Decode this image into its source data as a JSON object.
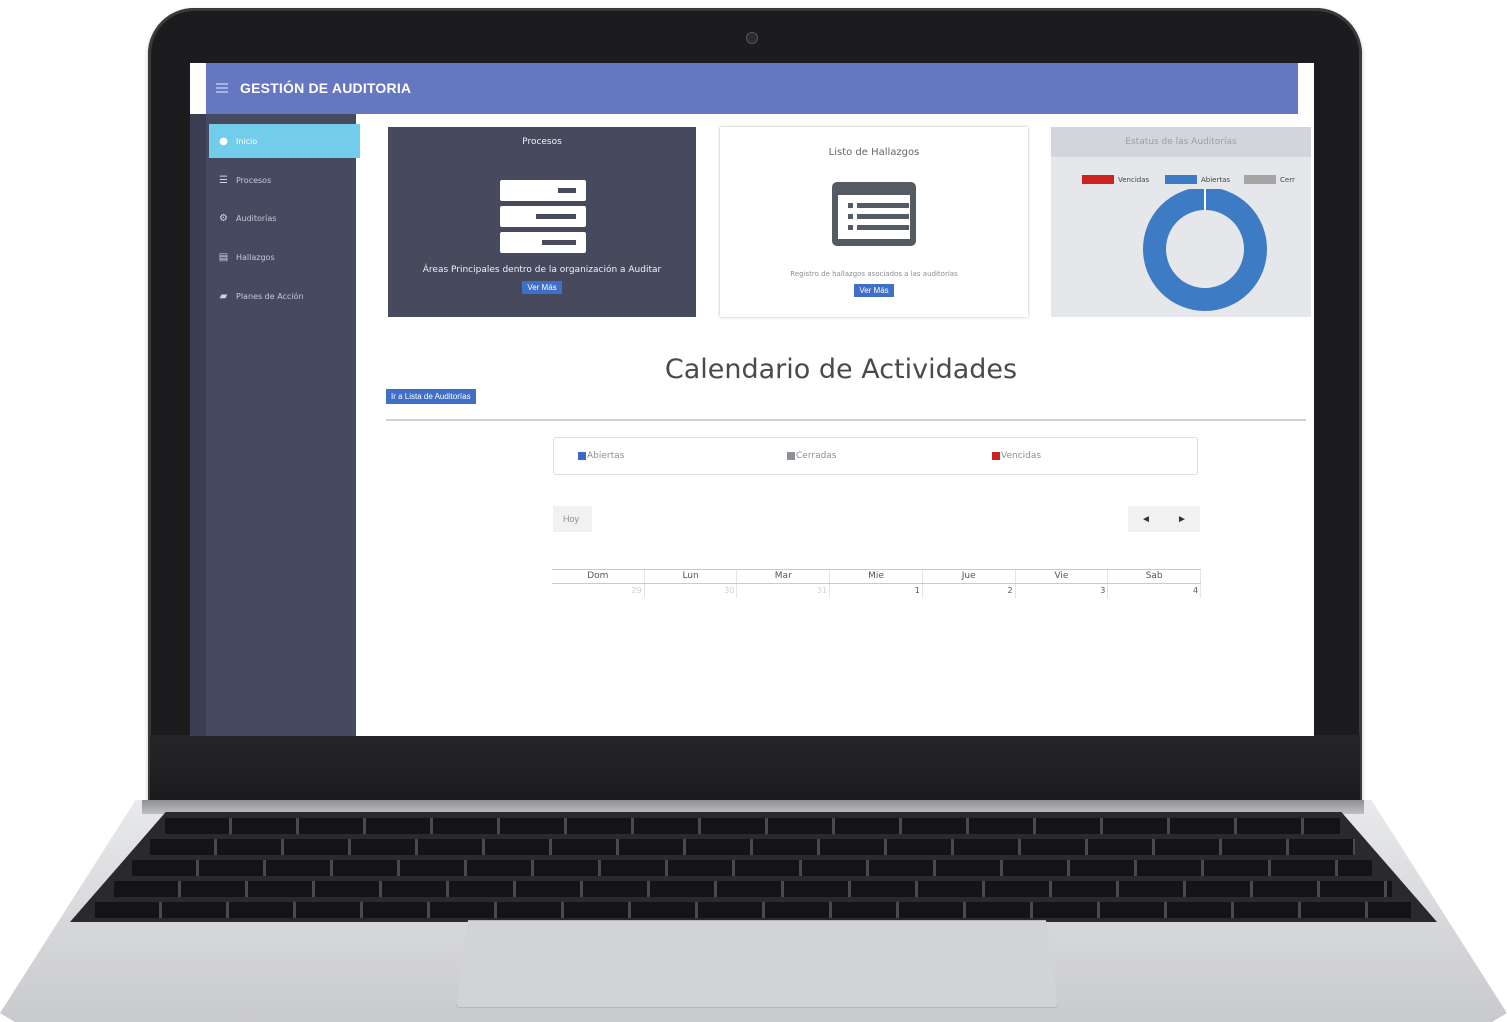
{
  "app": {
    "title": "GESTIÓN DE AUDITORIA"
  },
  "sidebar": {
    "items": [
      {
        "label": "Inicio",
        "icon": "dashboard-icon",
        "active": true
      },
      {
        "label": "Procesos",
        "icon": "server-icon",
        "active": false
      },
      {
        "label": "Auditorías",
        "icon": "cogs-icon",
        "active": false
      },
      {
        "label": "Hallazgos",
        "icon": "list-icon",
        "active": false
      },
      {
        "label": "Planes de Acción",
        "icon": "book-icon",
        "active": false
      }
    ]
  },
  "cards": {
    "procesos": {
      "title": "Procesos",
      "description": "Áreas Principales dentro de la organización a Auditar",
      "button": "Ver Más",
      "icon": "server-icon"
    },
    "hallazgos": {
      "title": "Listo de Hallazgos",
      "description": "Registro de hallazgos asociados a las auditorías",
      "button": "Ver Más",
      "icon": "list-icon"
    },
    "estatus": {
      "title": "Estatus de las Auditorías",
      "legend": [
        {
          "label": "Vencidas",
          "color": "#cc2222"
        },
        {
          "label": "Abiertas",
          "color": "#3d7cc4"
        },
        {
          "label": "Cerr",
          "color": "#a6a6a6"
        }
      ]
    }
  },
  "chart_data": {
    "type": "pie",
    "title": "Estatus de las Auditorías",
    "donut": true,
    "legend_position": "top",
    "slices": [
      {
        "label": "Vencidas",
        "value": 0,
        "color": "#cc2222"
      },
      {
        "label": "Abiertas",
        "value": 100,
        "color": "#3d7cc4"
      },
      {
        "label": "Cerradas",
        "value": 0,
        "color": "#a6a6a6"
      }
    ]
  },
  "calendar": {
    "title": "Calendario de Actividades",
    "list_button": "Ir a Lista de Auditorías",
    "legend": [
      {
        "label": "Abiertas",
        "color": "#3d68c4"
      },
      {
        "label": "Cerradas",
        "color": "#8d8f96"
      },
      {
        "label": "Vencidas",
        "color": "#cc2222"
      }
    ],
    "today_button": "Hoy",
    "prev_icon": "◄",
    "next_icon": "►",
    "weekdays": [
      "Dom",
      "Lun",
      "Mar",
      "Mie",
      "Jue",
      "Vie",
      "Sab"
    ],
    "week1": [
      "29",
      "30",
      "31",
      "1",
      "2",
      "3",
      "4"
    ]
  }
}
